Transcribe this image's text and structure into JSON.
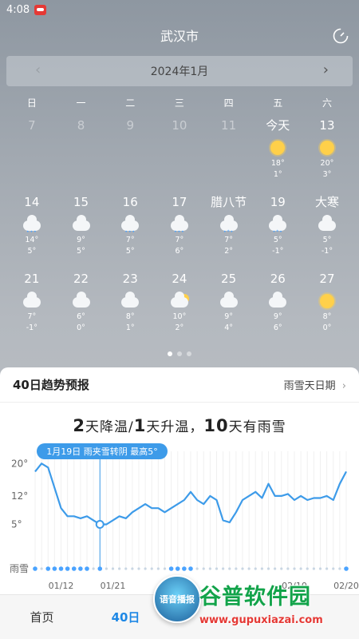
{
  "status_bar": {
    "time": "4:08"
  },
  "header": {
    "city": "武汉市"
  },
  "calendar": {
    "month_label": "2024年1月",
    "prev_arrow": "‹",
    "next_arrow": "›",
    "weekdays": [
      "日",
      "一",
      "二",
      "三",
      "四",
      "五",
      "六"
    ],
    "rows": [
      [
        {
          "label": "7",
          "past": true
        },
        {
          "label": "8",
          "past": true
        },
        {
          "label": "9",
          "past": true
        },
        {
          "label": "10",
          "past": true
        },
        {
          "label": "11",
          "past": true
        },
        {
          "label": "今天",
          "icon": "sunny-icon",
          "hi": "18°",
          "lo": "1°"
        },
        {
          "label": "13",
          "icon": "sunny-icon",
          "hi": "20°",
          "lo": "3°"
        }
      ],
      [
        {
          "label": "14",
          "icon": "cloudy-rain-icon",
          "hi": "14°",
          "lo": "5°"
        },
        {
          "label": "15",
          "icon": "cloudy-icon",
          "hi": "9°",
          "lo": "5°"
        },
        {
          "label": "16",
          "icon": "cloudy-rain-icon",
          "hi": "7°",
          "lo": "5°"
        },
        {
          "label": "17",
          "icon": "cloudy-rain-icon",
          "hi": "7°",
          "lo": "6°"
        },
        {
          "label": "腊八节",
          "icon": "sleet-icon",
          "hi": "7°",
          "lo": "2°"
        },
        {
          "label": "19",
          "icon": "sleet-icon",
          "hi": "5°",
          "lo": "-1°"
        },
        {
          "label": "大寒",
          "icon": "cloudy-icon",
          "hi": "5°",
          "lo": "-1°"
        }
      ],
      [
        {
          "label": "21",
          "icon": "cloudy-icon",
          "hi": "7°",
          "lo": "-1°"
        },
        {
          "label": "22",
          "icon": "cloudy-icon",
          "hi": "6°",
          "lo": "0°"
        },
        {
          "label": "23",
          "icon": "cloudy-icon",
          "hi": "8°",
          "lo": "1°"
        },
        {
          "label": "24",
          "icon": "partly-cloudy-icon",
          "hi": "10°",
          "lo": "2°"
        },
        {
          "label": "25",
          "icon": "cloudy-icon",
          "hi": "9°",
          "lo": "4°"
        },
        {
          "label": "26",
          "icon": "cloudy-icon",
          "hi": "9°",
          "lo": "6°"
        },
        {
          "label": "27",
          "icon": "sunny-icon",
          "hi": "8°",
          "lo": "0°"
        }
      ]
    ]
  },
  "trend": {
    "title": "40日趋势预报",
    "link_label": "雨雪天日期",
    "link_arrow": "›",
    "summary_parts": {
      "cool_days": "2",
      "cool_text": "天降温/",
      "warm_days": "1",
      "warm_text": "天升温，",
      "rain_days": "10",
      "rain_text": "天有雨雪"
    },
    "tooltip": "1月19日 雨夹雪转阴 最高5°",
    "rain_snow_label": "雨雪",
    "colors": {
      "line": "#3d9be9",
      "rain": "#4aa3ff",
      "dot_inactive": "#c9d6e3"
    }
  },
  "chart_data": {
    "type": "line",
    "title": "",
    "x_tick_labels": [
      "01/12",
      "01/21",
      "02/10",
      "02/20"
    ],
    "y_tick_labels": [
      "20°",
      "12°",
      "5°"
    ],
    "y_ticks": [
      20,
      12,
      5
    ],
    "ylim": [
      -1,
      23
    ],
    "series": [
      {
        "values": [
          18,
          20,
          19,
          14,
          9,
          7,
          7,
          6.5,
          7,
          6,
          5,
          5,
          6,
          7,
          6.5,
          8,
          9,
          10,
          9,
          9,
          8,
          9,
          10,
          11,
          13,
          11,
          10,
          12,
          11,
          6,
          5.5,
          8,
          11,
          12,
          13,
          11.5,
          15,
          12,
          12,
          12.5,
          11,
          12,
          11,
          11.5,
          11.5,
          12,
          11,
          15,
          18
        ]
      }
    ],
    "highlight_index": 10,
    "rain_snow_days": [
      1,
      0,
      1,
      1,
      1,
      1,
      1,
      1,
      1,
      0,
      1,
      0,
      0,
      0,
      0,
      0,
      0,
      0,
      0,
      0,
      0,
      1,
      1,
      1,
      1,
      0,
      0,
      0,
      0,
      0,
      0,
      0,
      0,
      0,
      0,
      0,
      0,
      0,
      0,
      0,
      0,
      0,
      0,
      0,
      0,
      0,
      0,
      0,
      1
    ]
  },
  "bottom_nav": {
    "home": "首页",
    "forty_day": "40日"
  },
  "voice_button": {
    "label": "语音播报"
  },
  "watermark": {
    "big": "谷普软件园",
    "small": "www.gupuxiazai.com"
  }
}
